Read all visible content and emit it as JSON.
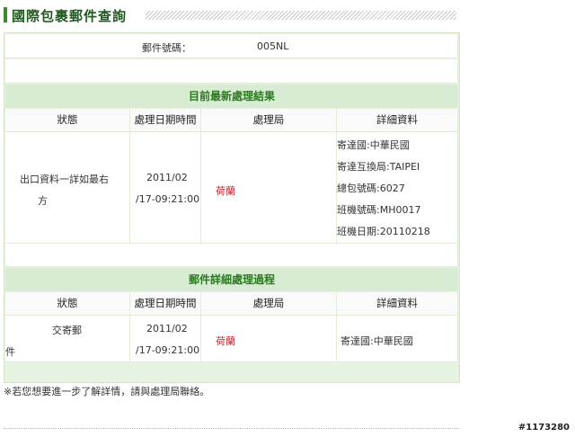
{
  "page_title": "國際包裹郵件查詢",
  "mail_number": {
    "label": "郵件號碼：",
    "value": "005NL"
  },
  "latest": {
    "heading": "目前最新處理結果",
    "columns": [
      "狀態",
      "處理日期時間",
      "處理局",
      "詳細資料"
    ],
    "row": {
      "status_line1": "出口資料一詳如最右",
      "status_line2": "方",
      "datetime_line1": "2011/02",
      "datetime_line2": "/17-09:21:00",
      "office": "荷蘭",
      "details": [
        "寄達國:中華民國",
        "寄達互換局:TAIPEI",
        "總包號碼:6027",
        "班機號碼:MH0017",
        "班機日期:20110218"
      ]
    }
  },
  "history": {
    "heading": "郵件詳細處理過程",
    "columns": [
      "狀態",
      "處理日期時間",
      "處理局",
      "詳細資料"
    ],
    "row": {
      "status_line1": "交寄郵",
      "status_line2": "件",
      "datetime_line1": "2011/02",
      "datetime_line2": "/17-09:21:00",
      "office": "荷蘭",
      "details": [
        "寄達國:中華民國"
      ]
    }
  },
  "note": "※若您想要進一步了解詳情，請與處理局聯絡。",
  "watermark": "#1173280",
  "colors": {
    "accent": "#2a7a1e",
    "office_text": "#c0262b",
    "panel_bg": "#e6f3e0",
    "header_bg": "#d7ecd2"
  }
}
